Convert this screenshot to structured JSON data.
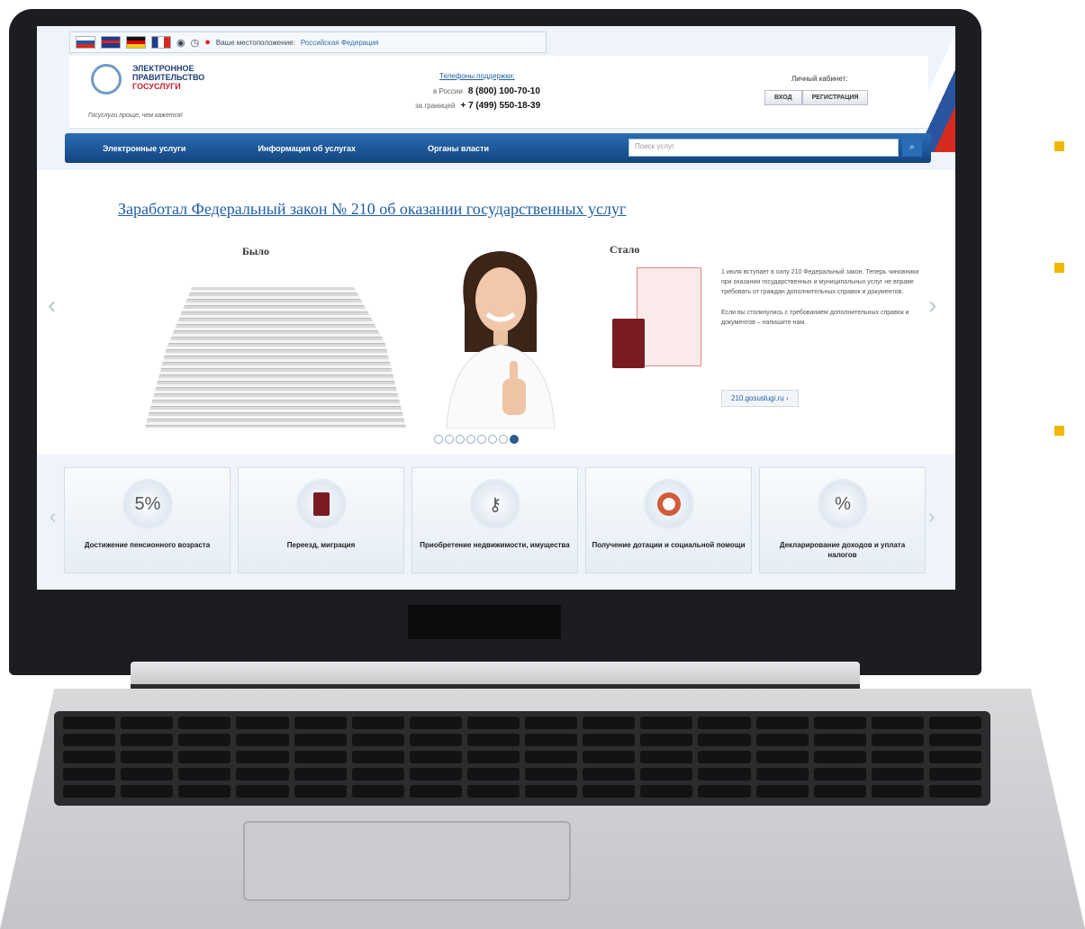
{
  "window": {
    "top_bar": {
      "languages": [
        "ru",
        "gb",
        "de",
        "fr"
      ],
      "icons": [
        "eye-icon",
        "clock-icon"
      ],
      "location_label": "Ваше местоположение:",
      "location_value": "Российская Федерация"
    },
    "header": {
      "logo_line1": "ЭЛЕКТРОННОЕ",
      "logo_line2": "ПРАВИТЕЛЬСТВО",
      "logo_line3": "ГОСУСЛУГИ",
      "slogan": "Госуслуги проще, чем кажется!",
      "phones_title": "Телефоны поддержки:",
      "phone_russia_label": "в России",
      "phone_russia": "8 (800) 100-70-10",
      "phone_abroad_label": "за границей",
      "phone_abroad": "+ 7 (499) 550-18-39",
      "cabinet_title": "Личный кабинет:",
      "login_label": "ВХОД",
      "register_label": "РЕГИСТРАЦИЯ"
    },
    "nav": {
      "items": [
        "Электронные услуги",
        "Информация об услугах",
        "Органы власти"
      ],
      "search_placeholder": "Поиск услуг"
    },
    "banner": {
      "headline": "Заработал Федеральный закон № 210 об оказании государственных услуг",
      "was_label": "Было",
      "now_label": "Стало",
      "desc_p1": "1 июля вступает в силу 210 Федеральный закон. Теперь чиновники при оказании государственных и муниципальных услуг не вправе требовать от граждан дополнительных справок и документов.",
      "desc_p2": "Если вы столкнулись с требованием дополнительных справок и документов – напишите нам.",
      "link_label": "210.gosuslugi.ru",
      "slides_total": 8,
      "slide_active": 8
    },
    "cards": [
      {
        "icon": "5%",
        "label": "Достижение пенсионного возраста"
      },
      {
        "icon": "passport-icon",
        "label": "Переезд, миграция"
      },
      {
        "icon": "keys-icon",
        "label": "Приобретение недвижимости, имущества"
      },
      {
        "icon": "lifebuoy-icon",
        "label": "Получение дотации и социальной помощи"
      },
      {
        "icon": "%",
        "label": "Декларирование доходов и уплата налогов"
      }
    ]
  },
  "colors": {
    "brand_blue": "#14457f",
    "link_blue": "#1f5fa5",
    "accent_bullet": "#f0b800"
  }
}
